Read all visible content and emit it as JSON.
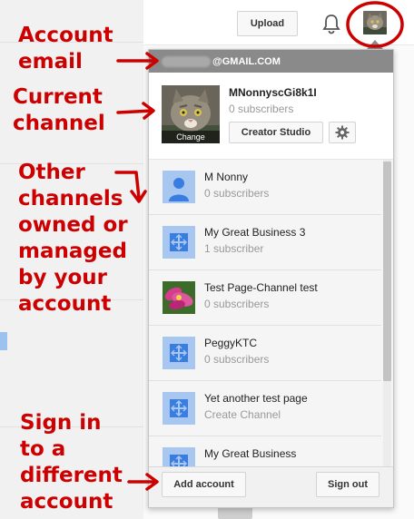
{
  "topbar": {
    "upload_label": "Upload",
    "bell_icon": "bell-icon",
    "avatar_icon": "cat-avatar"
  },
  "account": {
    "email_suffix": "@GMAIL.COM"
  },
  "current_channel": {
    "name": "MNonnyscGi8k1I",
    "subscribers": "0 subscribers",
    "change_label": "Change",
    "creator_studio_label": "Creator Studio",
    "settings_icon": "gear-icon"
  },
  "channels": [
    {
      "name": "M Nonny",
      "sub": "0 subscribers",
      "icon": "person-icon"
    },
    {
      "name": "My Great Business 3",
      "sub": "1 subscriber",
      "icon": "page-icon"
    },
    {
      "name": "Test Page-Channel test",
      "sub": "0 subscribers",
      "icon": "flower-photo"
    },
    {
      "name": "PeggyKTC",
      "sub": "0 subscribers",
      "icon": "page-icon"
    },
    {
      "name": "Yet another test page",
      "sub": "Create Channel",
      "icon": "page-icon"
    },
    {
      "name": "My Great Business",
      "sub": "",
      "icon": "page-icon"
    }
  ],
  "footer": {
    "add_account_label": "Add account",
    "sign_out_label": "Sign out"
  },
  "annotations": {
    "email": "Account\nemail",
    "current": "Current\nchannel",
    "others": "Other\nchannels\nowned or\nmanaged\nby your\naccount",
    "signin": "Sign in\nto a\ndifferent\naccount"
  },
  "colors": {
    "annotation": "#cc0000",
    "channel_icon_bg": "#a8c7f0",
    "channel_icon_fg": "#3a7de0"
  }
}
